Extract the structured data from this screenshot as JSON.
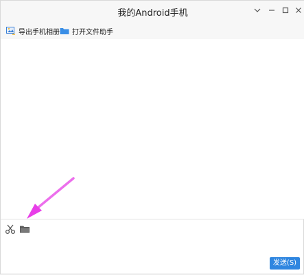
{
  "window": {
    "title": "我的Android手机"
  },
  "toolbar": {
    "export_album": "导出手机相册",
    "open_file_assistant": "打开文件助手"
  },
  "compose": {
    "send_label": "发送(S)"
  },
  "colors": {
    "accent": "#2f86e0",
    "annotation_arrow": "#e83ee8"
  },
  "icons": {
    "toolbar": [
      "image-export-icon",
      "folder-icon"
    ],
    "compose_tools": [
      "scissors-icon",
      "folder-icon"
    ],
    "window_controls": [
      "chevron-down-icon",
      "minimize-icon",
      "maximize-icon",
      "close-icon"
    ]
  }
}
